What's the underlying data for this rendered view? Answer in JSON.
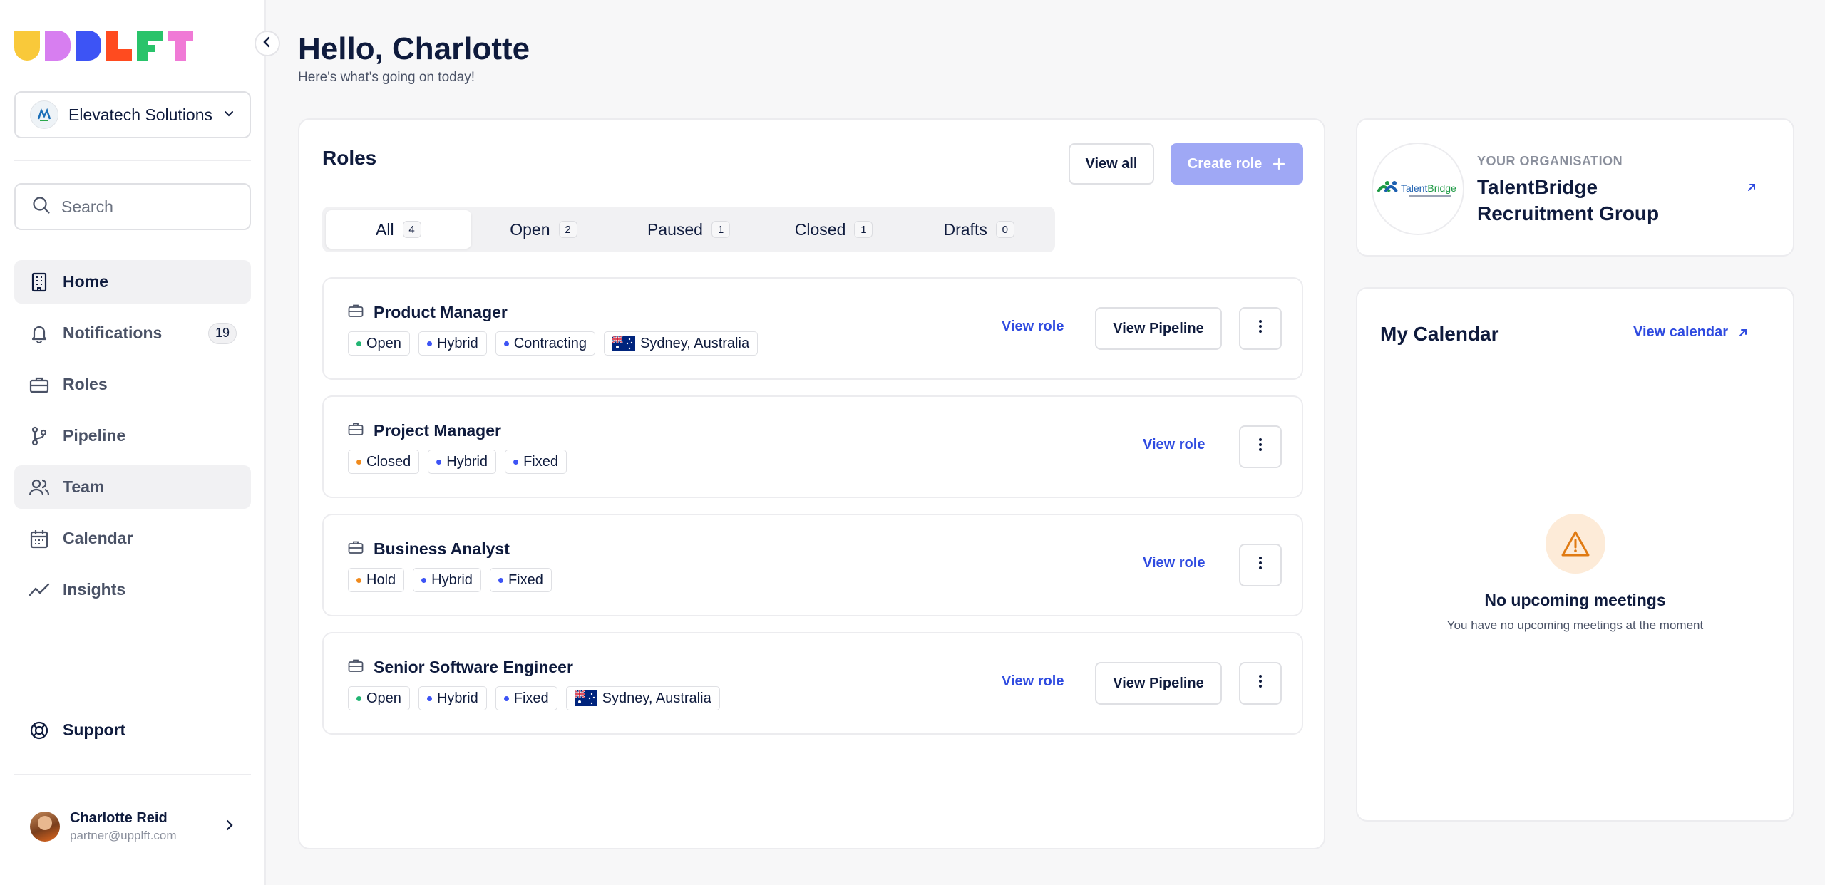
{
  "app": {
    "logo_letters": [
      "U",
      "P",
      "P",
      "L",
      "F",
      "T"
    ],
    "logo_colors": [
      "#f9c93a",
      "#d77ef0",
      "#3d54f5",
      "#ff4b1f",
      "#29c36a",
      "#f07ad6"
    ]
  },
  "sidebar": {
    "org_select": {
      "name": "Elevatech Solutions"
    },
    "search": {
      "placeholder": "Search"
    },
    "items": [
      {
        "label": "Home",
        "icon": "building-icon",
        "active": true
      },
      {
        "label": "Notifications",
        "icon": "bell-icon",
        "badge": "19"
      },
      {
        "label": "Roles",
        "icon": "briefcase-icon"
      },
      {
        "label": "Pipeline",
        "icon": "branch-icon"
      },
      {
        "label": "Team",
        "icon": "users-icon"
      },
      {
        "label": "Calendar",
        "icon": "calendar-icon"
      },
      {
        "label": "Insights",
        "icon": "trend-icon"
      }
    ],
    "support": {
      "label": "Support",
      "icon": "lifebuoy-icon"
    },
    "user": {
      "name": "Charlotte Reid",
      "email": "partner@upplft.com"
    }
  },
  "header": {
    "greeting": "Hello, Charlotte",
    "subtitle": "Here's what's going on today!"
  },
  "roles": {
    "title": "Roles",
    "view_all_label": "View all",
    "create_role_label": "Create role",
    "tabs": [
      {
        "label": "All",
        "count": "4",
        "active": true
      },
      {
        "label": "Open",
        "count": "2"
      },
      {
        "label": "Paused",
        "count": "1"
      },
      {
        "label": "Closed",
        "count": "1"
      },
      {
        "label": "Drafts",
        "count": "0"
      }
    ],
    "cards": [
      {
        "title": "Product Manager",
        "status": "Open",
        "status_color": "#22b573",
        "work_mode": "Hybrid",
        "contract": "Contracting",
        "location": "Sydney, Australia",
        "view_role_label": "View role",
        "view_pipeline_label": "View Pipeline"
      },
      {
        "title": "Project Manager",
        "status": "Closed",
        "status_color": "#f08a1c",
        "work_mode": "Hybrid",
        "contract": "Fixed",
        "view_role_label": "View role"
      },
      {
        "title": "Business Analyst",
        "status": "Hold",
        "status_color": "#f08a1c",
        "work_mode": "Hybrid",
        "contract": "Fixed",
        "view_role_label": "View role"
      },
      {
        "title": "Senior Software Engineer",
        "status": "Open",
        "status_color": "#22b573",
        "work_mode": "Hybrid",
        "contract": "Fixed",
        "location": "Sydney, Australia",
        "view_role_label": "View role",
        "view_pipeline_label": "View Pipeline"
      }
    ],
    "chip_dot_color": "#3d54f5"
  },
  "organisation": {
    "label": "YOUR ORGANISATION",
    "name": "TalentBridge Recruitment Group"
  },
  "calendar": {
    "title": "My Calendar",
    "view_label": "View calendar",
    "empty_title": "No upcoming meetings",
    "empty_subtitle": "You have no upcoming meetings at the moment"
  },
  "colors": {
    "accent": "#2f4be0",
    "primary_disabled": "#9fa8f5",
    "text": "#0f1b3d"
  }
}
